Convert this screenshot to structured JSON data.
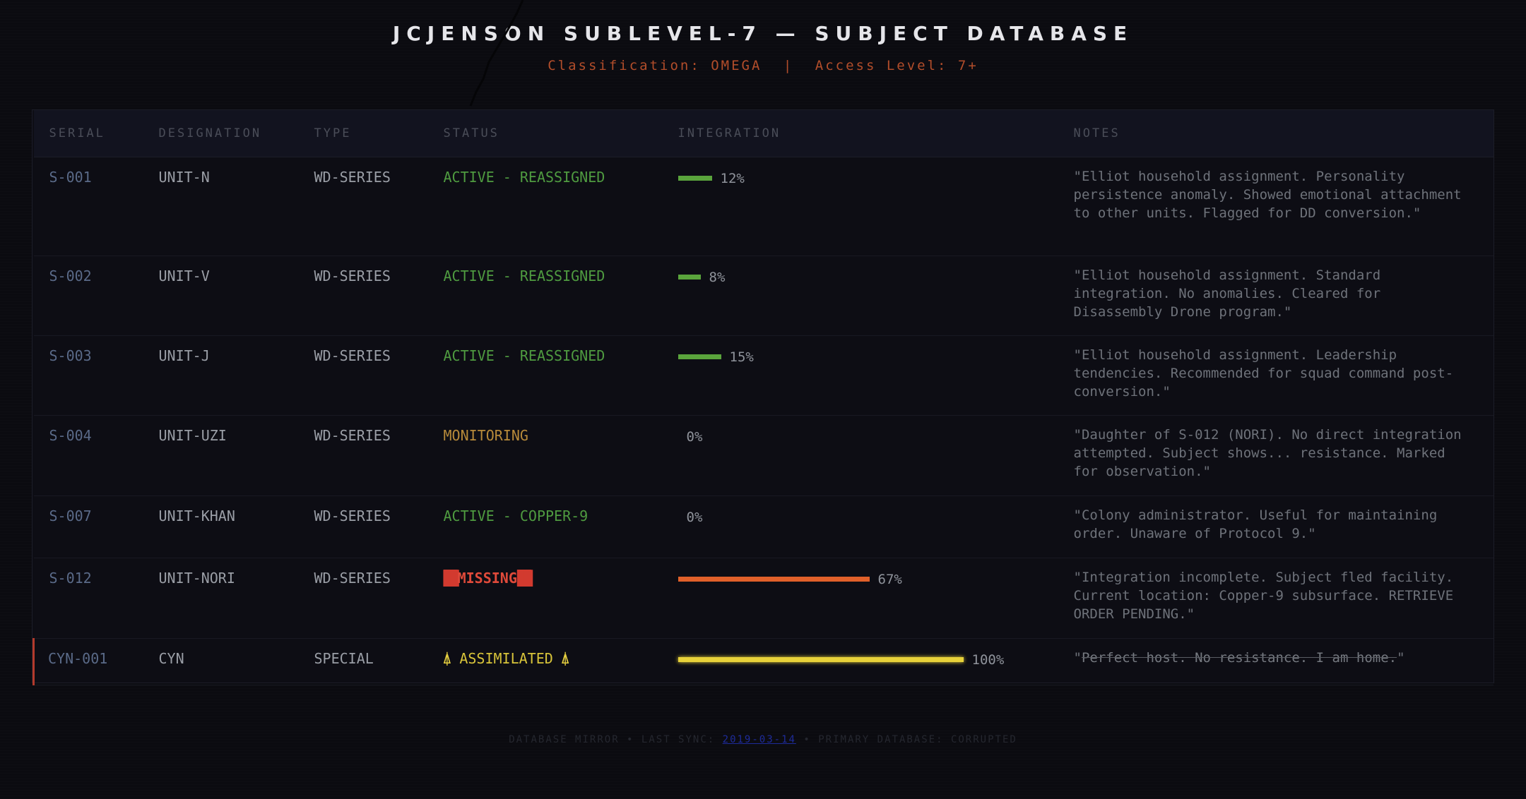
{
  "header": {
    "title": "JCJENSON SUBLEVEL-7 — SUBJECT DATABASE",
    "classification": "Classification: OMEGA",
    "separator": "|",
    "access": "Access Level: 7+"
  },
  "table": {
    "columns": [
      "SERIAL",
      "DESIGNATION",
      "TYPE",
      "STATUS",
      "INTEGRATION",
      "NOTES"
    ],
    "rows": [
      {
        "serial": "S-001",
        "designation": "UNIT-N",
        "type": "WD-SERIES",
        "status": "ACTIVE - REASSIGNED",
        "status_kind": "green",
        "integration": 12,
        "integration_label": "12%",
        "notes": "\"Elliot household assignment. Personality persistence anomaly. Showed emotional attachment to other units. Flagged for DD conversion.\""
      },
      {
        "serial": "S-002",
        "designation": "UNIT-V",
        "type": "WD-SERIES",
        "status": "ACTIVE - REASSIGNED",
        "status_kind": "green",
        "integration": 8,
        "integration_label": "8%",
        "notes": "\"Elliot household assignment. Standard integration. No anomalies. Cleared for Disassembly Drone program.\""
      },
      {
        "serial": "S-003",
        "designation": "UNIT-J",
        "type": "WD-SERIES",
        "status": "ACTIVE - REASSIGNED",
        "status_kind": "green",
        "integration": 15,
        "integration_label": "15%",
        "notes": "\"Elliot household assignment. Leadership tendencies. Recommended for squad command post-conversion.\""
      },
      {
        "serial": "S-004",
        "designation": "UNIT-UZI",
        "type": "WD-SERIES",
        "status": "MONITORING",
        "status_kind": "amber",
        "integration": 0,
        "integration_label": "0%",
        "notes": "\"Daughter of S-012 (NORI). No direct integration attempted. Subject shows... resistance. Marked for observation.\""
      },
      {
        "serial": "S-007",
        "designation": "UNIT-KHAN",
        "type": "WD-SERIES",
        "status": "ACTIVE - COPPER-9",
        "status_kind": "green",
        "integration": 0,
        "integration_label": "0%",
        "notes": "\"Colony administrator. Useful for maintaining order. Unaware of Protocol 9.\""
      },
      {
        "serial": "S-012",
        "designation": "UNIT-NORI",
        "type": "WD-SERIES",
        "status": "MISSING",
        "status_kind": "missing",
        "status_redact": "██",
        "integration": 67,
        "integration_label": "67%",
        "notes": "\"Integration incomplete. Subject fled facility. Current location: Copper-9 subsurface. RETRIEVE ORDER PENDING.\""
      },
      {
        "serial": "CYN-001",
        "designation": "CYN",
        "type": "SPECIAL",
        "status": "ASSIMILATED",
        "status_kind": "assimilated",
        "status_icon": "⍋",
        "integration": 100,
        "integration_label": "100%",
        "notes_open": "\"",
        "notes": "Perfect host. No resistance. I am home.",
        "notes_close": "\""
      }
    ]
  },
  "footer": {
    "text_before": "DATABASE MIRROR • LAST SYNC:",
    "link": "2019-03-14",
    "text_after": "• PRIMARY DATABASE: CORRUPTED"
  },
  "colors": {
    "green": "#5aa43c",
    "orange": "#e0602a",
    "yellow": "#e8d23a",
    "red": "#d23a2f",
    "accent": "#b24d2a"
  }
}
